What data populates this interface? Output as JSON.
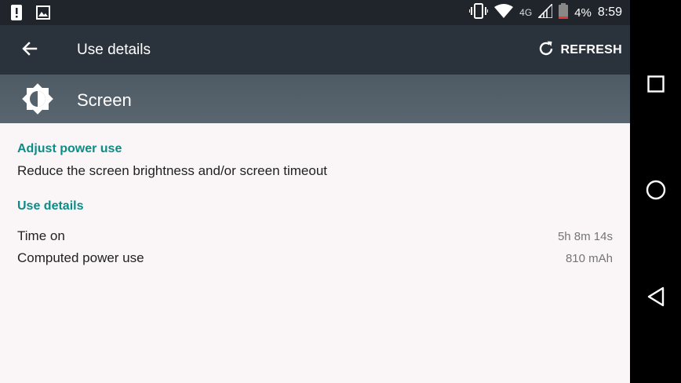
{
  "status_bar": {
    "left_icons": [
      "alert-icon",
      "image-icon"
    ],
    "right_icons": [
      "vibrate-icon",
      "wifi-icon",
      "lte-icon",
      "signal-icon",
      "battery-icon"
    ],
    "network": "4G",
    "battery": "4%",
    "time": "8:59"
  },
  "app_bar": {
    "title": "Use details",
    "refresh_label": "REFRESH"
  },
  "header": {
    "title": "Screen",
    "icon": "brightness-icon"
  },
  "sections": {
    "adjust": {
      "title": "Adjust power use",
      "text": "Reduce the screen brightness and/or screen timeout"
    },
    "details": {
      "title": "Use details",
      "rows": [
        {
          "label": "Time on",
          "value": "5h 8m 14s"
        },
        {
          "label": "Computed power use",
          "value": "810 mAh"
        }
      ]
    }
  },
  "colors": {
    "accent": "#0c8c86",
    "app_bar": "#2a333c",
    "header": "#55616b",
    "background": "#faf6f8"
  },
  "nav": {
    "icons": [
      "recents-icon",
      "home-icon",
      "back-icon"
    ]
  }
}
